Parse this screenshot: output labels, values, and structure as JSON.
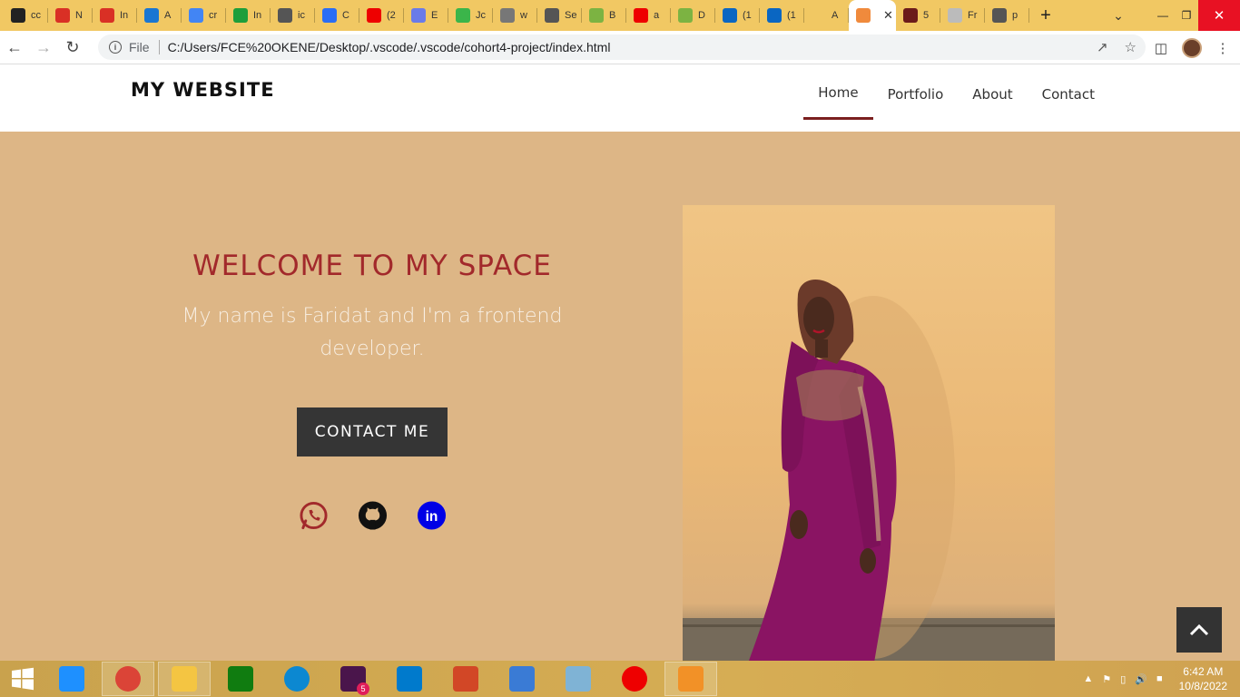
{
  "browser": {
    "tabs": [
      {
        "label": "cc",
        "icon": "github-icon",
        "color": "#222"
      },
      {
        "label": "N",
        "icon": "gmail-icon",
        "color": "#d93025"
      },
      {
        "label": "In",
        "icon": "gmail-icon",
        "color": "#d93025"
      },
      {
        "label": "A",
        "icon": "n-app-icon",
        "color": "#1976d2"
      },
      {
        "label": "cr",
        "icon": "google-icon",
        "color": "#4285f4"
      },
      {
        "label": "In",
        "icon": "green-app-icon",
        "color": "#1e9e3b"
      },
      {
        "label": "ic",
        "icon": "globe-icon",
        "color": "#555"
      },
      {
        "label": "C",
        "icon": "c-app-icon",
        "color": "#2a6df4"
      },
      {
        "label": "(2",
        "icon": "youtube-icon",
        "color": "#e00"
      },
      {
        "label": "E",
        "icon": "diamond-icon",
        "color": "#6a7be8"
      },
      {
        "label": "Jc",
        "icon": "check-icon",
        "color": "#3bb54a"
      },
      {
        "label": "w",
        "icon": "circle-x-icon",
        "color": "#777"
      },
      {
        "label": "Se",
        "icon": "settings-icon",
        "color": "#555"
      },
      {
        "label": "B",
        "icon": "refresh-icon",
        "color": "#7cb342"
      },
      {
        "label": "a",
        "icon": "youtube-icon",
        "color": "#e00"
      },
      {
        "label": "D",
        "icon": "refresh-icon",
        "color": "#7cb342"
      },
      {
        "label": "(1",
        "icon": "linkedin-icon",
        "color": "#0a66c2"
      },
      {
        "label": "(1",
        "icon": "linkedin-icon",
        "color": "#0a66c2"
      },
      {
        "label": "A",
        "icon": "blank-icon",
        "color": "#f1c863"
      },
      {
        "label": "",
        "icon": "site-icon",
        "color": "#f08a3c",
        "active": true
      },
      {
        "label": "5",
        "icon": "m-app-icon",
        "color": "#6b1a1a"
      },
      {
        "label": "Fr",
        "icon": "moon-icon",
        "color": "#bbb"
      },
      {
        "label": "p",
        "icon": "globe-icon",
        "color": "#555"
      }
    ],
    "scheme": "File",
    "url": "C:/Users/FCE%20OKENE/Desktop/.vscode/.vscode/cohort4-project/index.html"
  },
  "site": {
    "logo": "MY WEBSITE",
    "nav": [
      "Home",
      "Portfolio",
      "About",
      "Contact"
    ],
    "hero": {
      "title": "WELCOME TO MY SPACE",
      "subtitle": "My name is Faridat and I'm a frontend developer.",
      "cta": "CONTACT ME"
    },
    "socials": [
      "whatsapp-icon",
      "github-icon",
      "linkedin-icon"
    ]
  },
  "taskbar": {
    "apps": [
      "internet-explorer-icon",
      "chrome-icon",
      "file-explorer-icon",
      "store-icon",
      "edge-icon",
      "slack-icon",
      "vscode-icon",
      "powerpoint-icon",
      "photos-icon",
      "notepad-icon",
      "youtube-music-icon",
      "media-player-icon"
    ],
    "slack_badge": "5",
    "time": "6:42 AM",
    "date": "10/8/2022"
  },
  "colors": {
    "hero_bg": "#ddb686",
    "title": "#a2292b",
    "button": "#353535",
    "tabstrip": "#f1c863",
    "nav_active": "#7b1f1f"
  }
}
